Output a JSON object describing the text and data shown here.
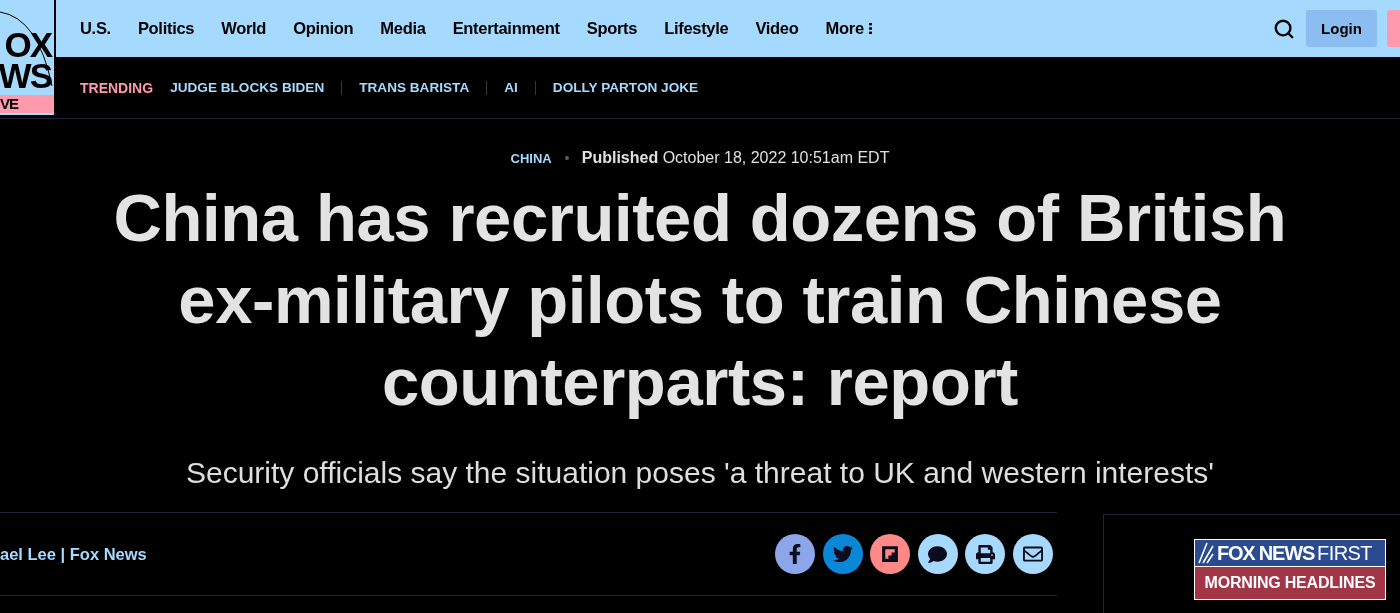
{
  "logo": {
    "lines": [
      "OX",
      "WS"
    ],
    "live": "VE"
  },
  "nav": {
    "items": [
      "U.S.",
      "Politics",
      "World",
      "Opinion",
      "Media",
      "Entertainment",
      "Sports",
      "Lifestyle",
      "Video"
    ],
    "more": "More",
    "login": "Login"
  },
  "trending": {
    "label": "TRENDING",
    "items": [
      "JUDGE BLOCKS BIDEN",
      "TRANS BARISTA",
      "AI",
      "DOLLY PARTON JOKE"
    ]
  },
  "article": {
    "category": "CHINA",
    "published": "**Published** October 18, 2022 10:51am EDT",
    "headline": "China has recruited dozens of British ex-military pilots to train Chinese counterparts: report",
    "subheadline": "Security officials say the situation poses 'a threat to UK and western interests'",
    "byline": "ael Lee | Fox News",
    "share": [
      {
        "kind": "facebook",
        "color": "#8ba7ea"
      },
      {
        "kind": "twitter",
        "color": "#0b87d7"
      },
      {
        "kind": "flipboard",
        "color": "#ff8888"
      },
      {
        "kind": "comments",
        "color": "#a6d9fe"
      },
      {
        "kind": "print",
        "color": "#a6d9fe"
      },
      {
        "kind": "email",
        "color": "#a6d9fe"
      }
    ]
  },
  "newsletter": {
    "brand": "FOX NEWS",
    "edition": "FIRST",
    "title": "MORNING HEADLINES"
  }
}
